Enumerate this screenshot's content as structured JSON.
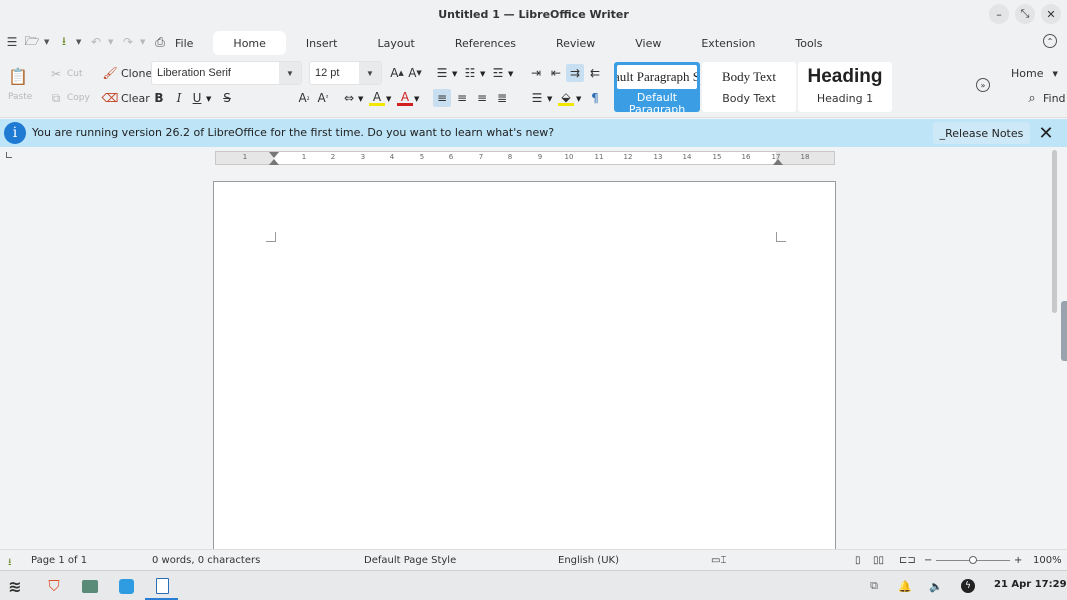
{
  "window": {
    "title": "Untitled 1 — LibreOffice Writer"
  },
  "tabs": [
    {
      "label": "File"
    },
    {
      "label": "Home"
    },
    {
      "label": "Insert"
    },
    {
      "label": "Layout"
    },
    {
      "label": "References"
    },
    {
      "label": "Review"
    },
    {
      "label": "View"
    },
    {
      "label": "Extension"
    },
    {
      "label": "Tools"
    }
  ],
  "active_tab": "Home",
  "ribbon": {
    "cut_label": "Cut",
    "copy_label": "Copy",
    "paste_label": "Paste",
    "clone_label": "Clone",
    "clear_label": "Clear",
    "font_name": "Liberation Serif",
    "font_size": "12 pt",
    "styles": [
      {
        "preview": "Default Paragraph Style",
        "label": "Default Paragraph Style",
        "selected": true
      },
      {
        "preview": "Body Text",
        "label": "Body Text"
      },
      {
        "preview": "Heading",
        "label": "Heading 1"
      }
    ],
    "home_dropdown": "Home",
    "find_label": "Find"
  },
  "infobar": {
    "message": "You are running version 26.2 of LibreOffice for the first time. Do you want to learn what's new?",
    "button_label": "_Release Notes"
  },
  "ruler": {
    "numbers": [
      "1",
      "1",
      "1",
      "2",
      "3",
      "4",
      "5",
      "6",
      "7",
      "8",
      "9",
      "10",
      "11",
      "12",
      "13",
      "14",
      "15",
      "16",
      "17",
      "18"
    ]
  },
  "status": {
    "page": "Page 1 of 1",
    "words": "0 words, 0 characters",
    "page_style": "Default Page Style",
    "language": "English (UK)",
    "zoom": "100%"
  },
  "taskbar": {
    "datetime": "21 Apr 17:29"
  },
  "colors": {
    "accent": "#3b9ee5",
    "infobar_bg": "#bde4f7",
    "info_icon": "#1e7ad3"
  }
}
